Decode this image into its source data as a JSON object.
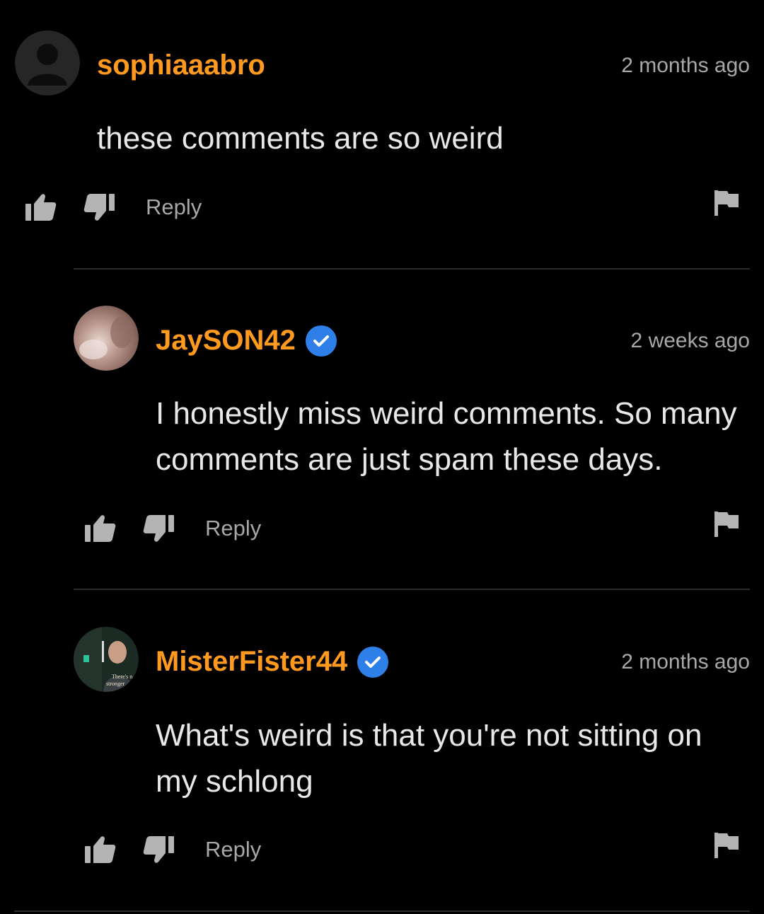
{
  "comments": [
    {
      "username": "sophiaaabro",
      "verified": false,
      "time": "2 months ago",
      "text": "these comments are so weird",
      "reply_label": "Reply"
    },
    {
      "username": "JaySON42",
      "verified": true,
      "time": "2 weeks ago",
      "text": "I honestly miss weird comments. So many comments are just spam these days.",
      "reply_label": "Reply"
    },
    {
      "username": "MisterFister44",
      "verified": true,
      "time": "2 months ago",
      "text": "What's weird is that you're not sitting on my schlong",
      "reply_label": "Reply",
      "avatar_caption_line1": "There's n",
      "avatar_caption_line2": "stronger"
    }
  ],
  "colors": {
    "background": "#000000",
    "username": "#ff9a1f",
    "muted": "#a8a8a8",
    "icon": "#b4b4b4",
    "verified": "#2f7fe8",
    "divider": "#2c2c2c"
  },
  "icons": {
    "like": "thumbs-up-icon",
    "dislike": "thumbs-down-icon",
    "flag": "flag-icon",
    "verified": "verified-check-icon"
  }
}
